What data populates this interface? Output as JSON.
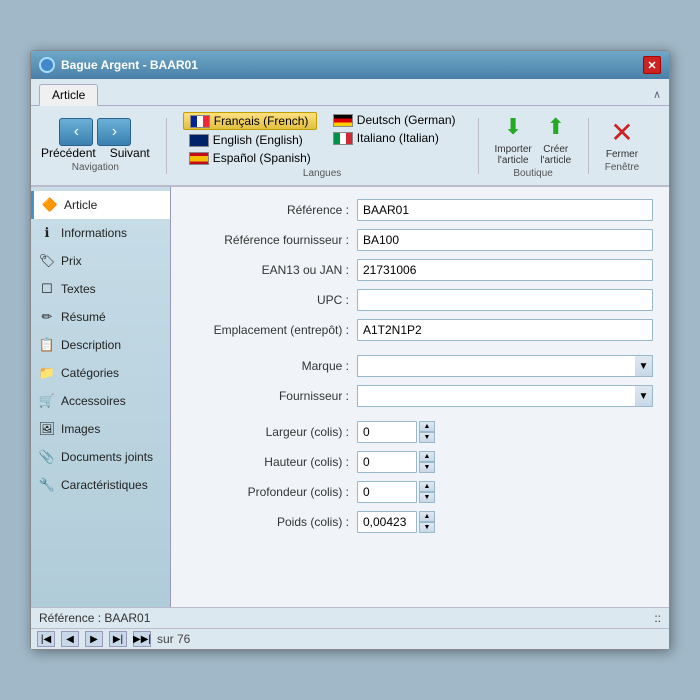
{
  "window": {
    "title": "Bague Argent - BAAR01",
    "close_label": "✕"
  },
  "tab": {
    "name": "Article",
    "arrow": "∧"
  },
  "toolbar": {
    "nav": {
      "prev_label": "Précédent",
      "next_label": "Suivant",
      "group_label": "Navigation",
      "prev_icon": "‹",
      "next_icon": "›"
    },
    "languages": {
      "group_label": "Langues",
      "items": [
        {
          "code": "fr",
          "label": "Français (French)",
          "active": true
        },
        {
          "code": "en",
          "label": "English (English)",
          "active": false
        },
        {
          "code": "es",
          "label": "Español (Spanish)",
          "active": false
        },
        {
          "code": "de",
          "label": "Deutsch (German)",
          "active": false
        },
        {
          "code": "it",
          "label": "Italiano (Italian)",
          "active": false
        }
      ]
    },
    "boutique": {
      "group_label": "Boutique",
      "import_label": "Importer\nl'article",
      "create_label": "Créer\nl'article",
      "import_icon": "⬇",
      "create_icon": "⬆"
    },
    "fenetre": {
      "group_label": "Fenêtre",
      "close_label": "Fermer",
      "close_icon": "✕"
    }
  },
  "sidebar": {
    "items": [
      {
        "id": "article",
        "label": "Article",
        "icon": "🔶",
        "active": true
      },
      {
        "id": "informations",
        "label": "Informations",
        "icon": "ℹ",
        "active": false
      },
      {
        "id": "prix",
        "label": "Prix",
        "icon": "🏷",
        "active": false
      },
      {
        "id": "textes",
        "label": "Textes",
        "icon": "☐",
        "active": false
      },
      {
        "id": "resume",
        "label": "Résumé",
        "icon": "✏",
        "active": false
      },
      {
        "id": "description",
        "label": "Description",
        "icon": "📋",
        "active": false
      },
      {
        "id": "categories",
        "label": "Catégories",
        "icon": "📁",
        "active": false
      },
      {
        "id": "accessoires",
        "label": "Accessoires",
        "icon": "🛒",
        "active": false
      },
      {
        "id": "images",
        "label": "Images",
        "icon": "🖼",
        "active": false
      },
      {
        "id": "documents",
        "label": "Documents joints",
        "icon": "📎",
        "active": false
      },
      {
        "id": "caracteristiques",
        "label": "Caractéristiques",
        "icon": "🔧",
        "active": false
      }
    ]
  },
  "form": {
    "fields": [
      {
        "id": "reference",
        "label": "Référence :",
        "value": "BAAR01",
        "type": "text"
      },
      {
        "id": "ref_fournisseur",
        "label": "Référence fournisseur :",
        "value": "BA100",
        "type": "text"
      },
      {
        "id": "ean13",
        "label": "EAN13 ou JAN :",
        "value": "21731006",
        "type": "text"
      },
      {
        "id": "upc",
        "label": "UPC :",
        "value": "",
        "type": "text"
      },
      {
        "id": "emplacement",
        "label": "Emplacement (entrepôt) :",
        "value": "A1T2N1P2",
        "type": "text"
      },
      {
        "id": "marque",
        "label": "Marque :",
        "value": "",
        "type": "select"
      },
      {
        "id": "fournisseur",
        "label": "Fournisseur :",
        "value": "",
        "type": "select"
      },
      {
        "id": "largeur",
        "label": "Largeur (colis) :",
        "value": "0",
        "type": "spinner"
      },
      {
        "id": "hauteur",
        "label": "Hauteur (colis) :",
        "value": "0",
        "type": "spinner"
      },
      {
        "id": "profondeur",
        "label": "Profondeur (colis) :",
        "value": "0",
        "type": "spinner"
      },
      {
        "id": "poids",
        "label": "Poids (colis) :",
        "value": "0,00423",
        "type": "spinner"
      }
    ]
  },
  "status_bar": {
    "text": "Référence : BAAR01",
    "corner": "::"
  },
  "pagination": {
    "sur": "sur 76",
    "btn_first": "|◀",
    "btn_prev": "◀",
    "btn_next": "▶",
    "btn_last": "▶|",
    "btn_more": "▶▶|"
  }
}
